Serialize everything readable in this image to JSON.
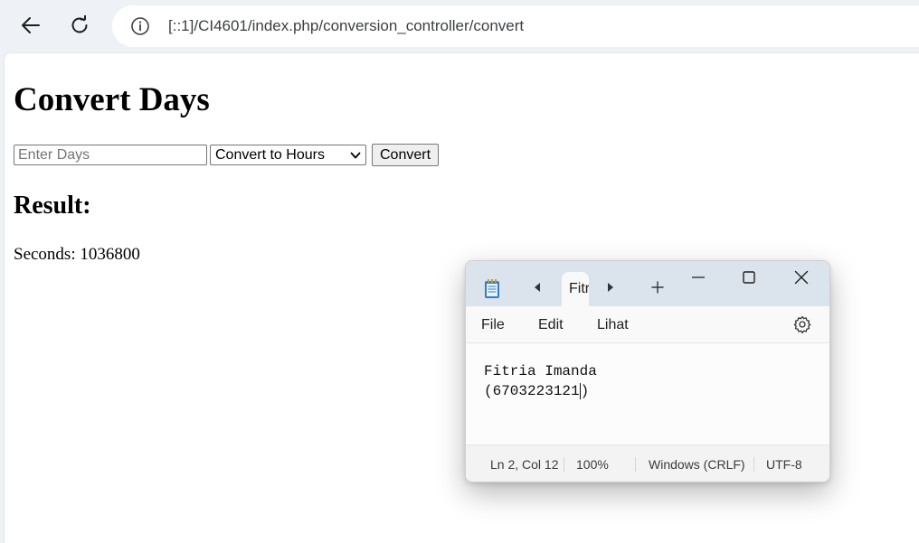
{
  "browser": {
    "back_icon": "arrow-left-icon",
    "reload_icon": "reload-icon",
    "info_icon": "info-icon",
    "url": "[::1]/CI4601/index.php/conversion_controller/convert"
  },
  "page": {
    "title": "Convert Days",
    "form": {
      "days_placeholder": "Enter Days",
      "days_value": "",
      "unit_selected": "Convert to Hours",
      "submit_label": "Convert"
    },
    "result": {
      "heading": "Result:",
      "text": "Seconds: 1036800"
    }
  },
  "notepad": {
    "tab_label": "Fitria Imanda",
    "menu": {
      "file": "File",
      "edit": "Edit",
      "view": "Lihat"
    },
    "content": {
      "line1": "Fitria Imanda",
      "line2": "(6703223121",
      "line2_after_caret": ")"
    },
    "status": {
      "position": "Ln 2, Col 12",
      "zoom": "100%",
      "line_ending": "Windows (CRLF)",
      "encoding": "UTF-8"
    },
    "colors": {
      "titlebar": "#dbe3ec",
      "background": "#f9f9f9"
    }
  }
}
